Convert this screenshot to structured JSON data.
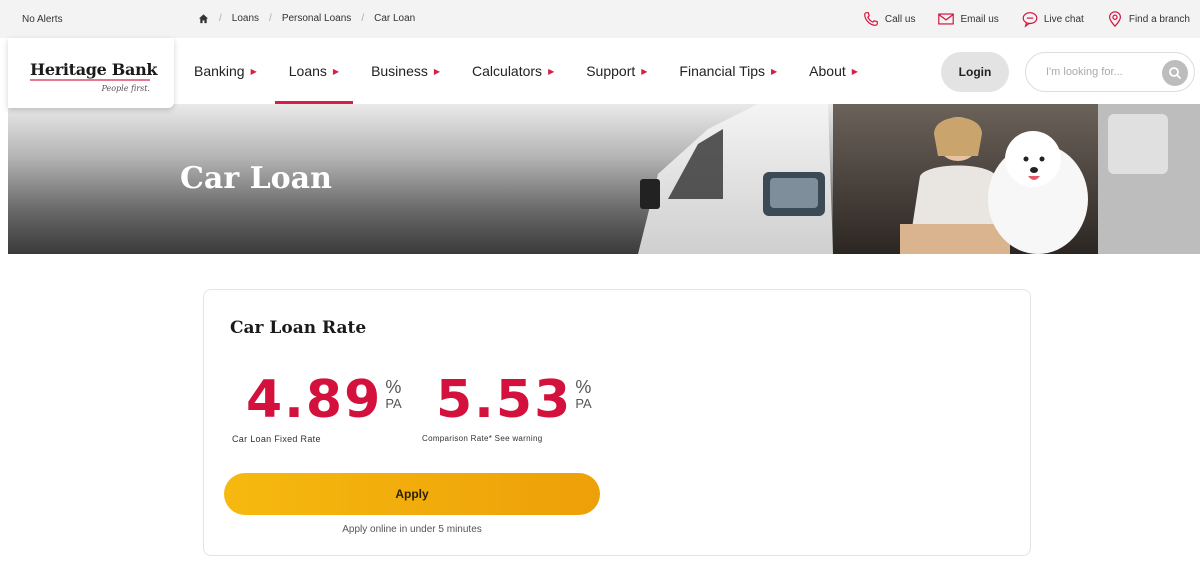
{
  "utility_bar": {
    "alerts": "No Alerts",
    "breadcrumb": [
      "Loans",
      "Personal Loans",
      "Car Loan"
    ],
    "links": [
      {
        "label": "Call us",
        "icon": "phone-icon"
      },
      {
        "label": "Email us",
        "icon": "mail-icon"
      },
      {
        "label": "Live chat",
        "icon": "chat-icon"
      },
      {
        "label": "Find a branch",
        "icon": "location-pin-icon"
      }
    ]
  },
  "brand": {
    "name": "Heritage Bank",
    "tagline": "People first."
  },
  "nav": {
    "items": [
      {
        "label": "Banking"
      },
      {
        "label": "Loans"
      },
      {
        "label": "Business"
      },
      {
        "label": "Calculators"
      },
      {
        "label": "Support"
      },
      {
        "label": "Financial Tips"
      },
      {
        "label": "About"
      }
    ],
    "active": "Loans",
    "login_label": "Login",
    "search_placeholder": "I'm looking for..."
  },
  "hero": {
    "title": "Car Loan"
  },
  "rate_card": {
    "title": "Car Loan Rate",
    "fixed_rate": {
      "value": "4.89",
      "unit": "%",
      "period": "PA",
      "label": "Car Loan Fixed Rate"
    },
    "comparison_rate": {
      "value": "5.53",
      "unit": "%",
      "period": "PA",
      "label": "Comparison Rate* See warning"
    },
    "apply_label": "Apply",
    "apply_note": "Apply online in under 5 minutes"
  },
  "colors": {
    "accent": "#d4103c",
    "button": "#f2b00c",
    "utility_bg": "#f3f3f3"
  }
}
